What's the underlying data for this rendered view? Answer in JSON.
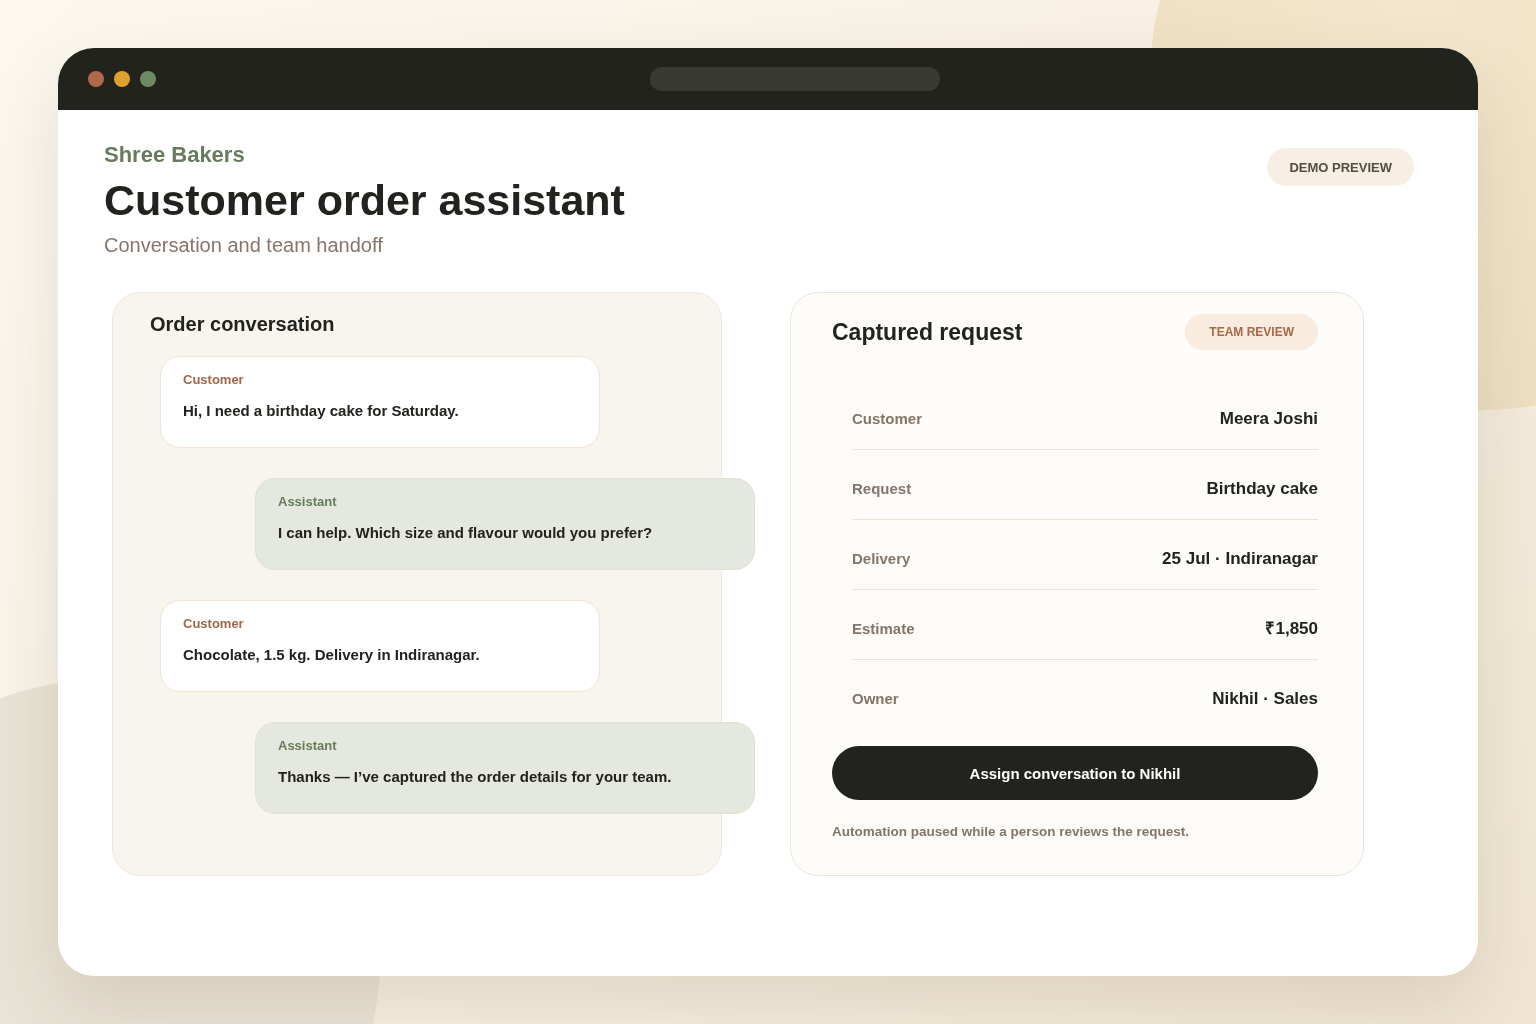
{
  "header": {
    "brand": "Shree Bakers",
    "title": "Customer order assistant",
    "subtitle": "Conversation and team handoff",
    "badge": "DEMO PREVIEW"
  },
  "conversation": {
    "title": "Order conversation",
    "messages": [
      {
        "kind": "customer",
        "sender": "Customer",
        "text": "Hi, I need a birthday cake for Saturday."
      },
      {
        "kind": "assistant",
        "sender": "Assistant",
        "text": "I can help. Which size and flavour would you prefer?"
      },
      {
        "kind": "customer",
        "sender": "Customer",
        "text": "Chocolate, 1.5 kg. Delivery in Indiranagar."
      },
      {
        "kind": "assistant",
        "sender": "Assistant",
        "text": "Thanks — I’ve captured the order details for your team."
      }
    ]
  },
  "request": {
    "title": "Captured request",
    "status": "TEAM REVIEW",
    "fields": [
      {
        "label": "Customer",
        "value": "Meera Joshi"
      },
      {
        "label": "Request",
        "value": "Birthday cake"
      },
      {
        "label": "Delivery",
        "value": "25 Jul · Indiranagar"
      },
      {
        "label": "Estimate",
        "value": "₹1,850"
      },
      {
        "label": "Owner",
        "value": "Nikhil · Sales"
      }
    ],
    "action": "Assign conversation to Nikhil",
    "note": "Automation paused while a person reviews the request."
  }
}
